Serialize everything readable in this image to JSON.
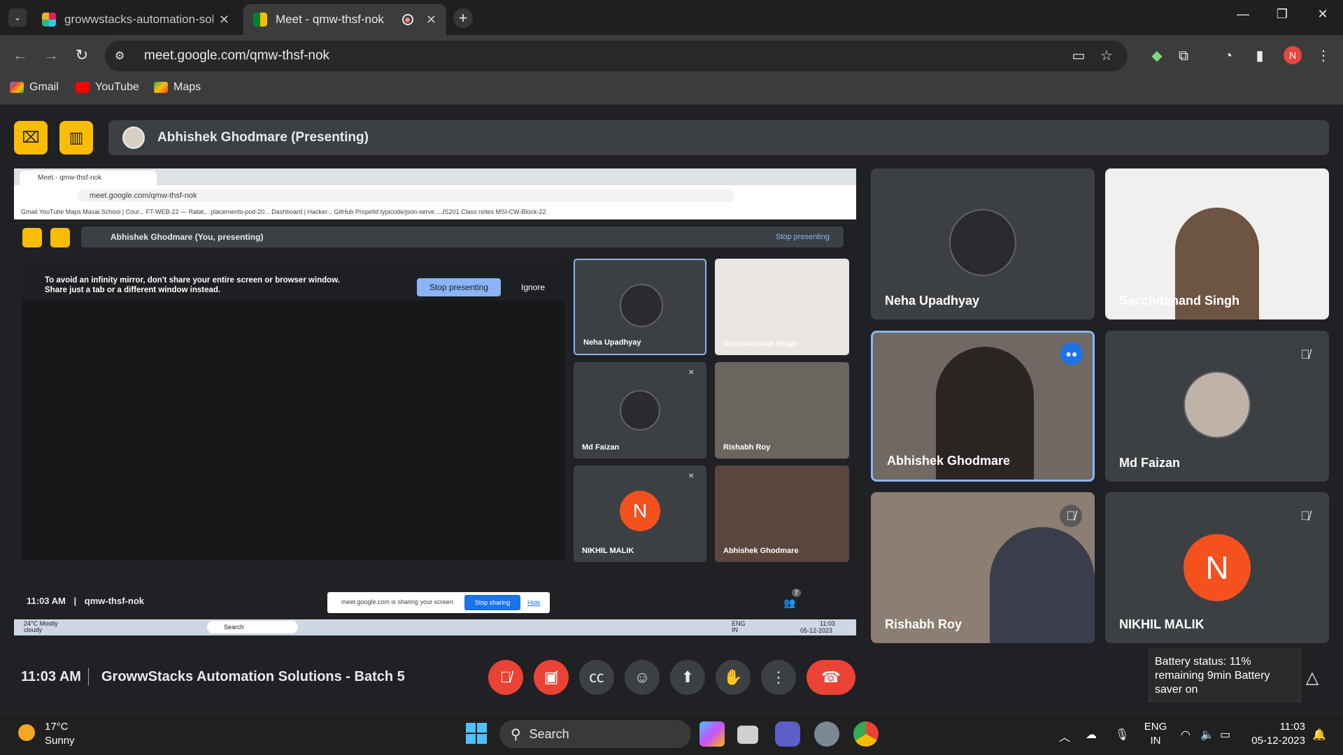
{
  "browser": {
    "tabs": [
      {
        "title": "growwstacks-automation-solu",
        "active": false
      },
      {
        "title": "Meet - qmw-thsf-nok",
        "active": true
      }
    ],
    "url": "meet.google.com/qmw-thsf-nok",
    "profile_initial": "N",
    "bookmarks": [
      "Gmail",
      "YouTube",
      "Maps"
    ]
  },
  "meet": {
    "presenter_banner": "Abhishek Ghodmare (Presenting)",
    "presentation": {
      "tab_title": "Meet - qmw-thsf-nok",
      "url": "meet.google.com/qmw-thsf-nok",
      "bookmarks": "Gmail   YouTube   Maps   Masai School | Cour...   FT-WEB-22 — Ratat...   placements-pod-20...   Dashboard | Hacker...   GitHub   Propelld   typicode/json-serve...   JS201 Class notes   MSI-CW-Block-22",
      "presenting_label": "Abhishek Ghodmare (You, presenting)",
      "stop_presenting": "Stop presenting",
      "warning": "To avoid an infinity mirror, don't share your entire screen or browser window. Share just a tab or a different window instead.",
      "warning_stop": "Stop presenting",
      "warning_ignore": "Ignore",
      "tiles": [
        "Neha Upadhyay",
        "Sacchitanand Singh",
        "Md Faizan",
        "Rishabh Roy",
        "NIKHIL MALIK",
        "Abhishek Ghodmare"
      ],
      "nikhil_initial": "N",
      "time": "11:03 AM",
      "meeting_code": "qmw-thsf-nok",
      "sharing_text": "meet.google.com is sharing your screen.",
      "stop_sharing": "Stop sharing",
      "hide": "Hide",
      "taskbar_weather": "24°C Mostly cloudy",
      "taskbar_search": "Search",
      "taskbar_lang": "ENG IN",
      "taskbar_time": "11:03",
      "taskbar_date": "05-12-2023",
      "people_count": "7"
    },
    "participants": [
      {
        "name": "Neha Upadhyay"
      },
      {
        "name": "Sacchitanand Singh"
      },
      {
        "name": "Abhishek Ghodmare"
      },
      {
        "name": "Md Faizan"
      },
      {
        "name": "Rishabh Roy"
      },
      {
        "name": "NIKHIL MALIK",
        "initial": "N"
      }
    ],
    "footer": {
      "time": "11:03 AM",
      "title": "GrowwStacks Automation Solutions - Batch 5"
    },
    "battery_tooltip": "Battery status: 11% remaining 9min Battery saver on"
  },
  "taskbar": {
    "weather_temp": "17°C",
    "weather_desc": "Sunny",
    "search": "Search",
    "lang_1": "ENG",
    "lang_2": "IN",
    "time": "11:03",
    "date": "05-12-2023"
  },
  "colors": {
    "accent_yellow": "#fbbc04",
    "end_call": "#ea4335",
    "speaking": "#8ab4f8",
    "initial_bg": "#f4511e"
  }
}
